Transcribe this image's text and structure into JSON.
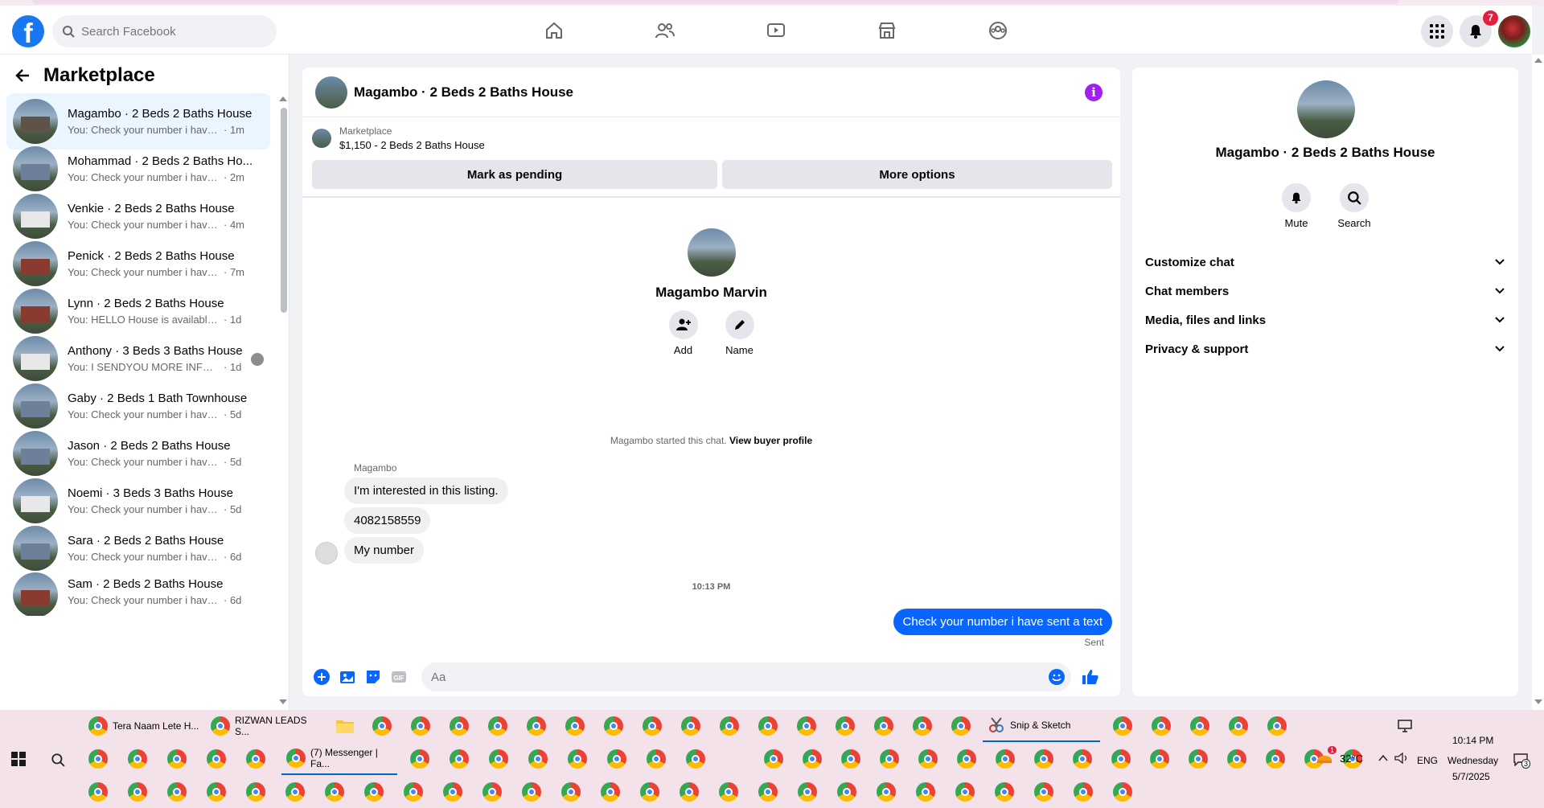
{
  "header": {
    "logo": "f",
    "search_placeholder": "Search Facebook",
    "notification_count": "7"
  },
  "left": {
    "title": "Marketplace",
    "conversations": [
      {
        "name": "Magambo · 2 Beds 2 Baths House",
        "preview": "You: Check your number i have se...",
        "time": "· 1m"
      },
      {
        "name": "Mohammad · 2 Beds 2 Baths Ho...",
        "preview": "You: Check your number i have se...",
        "time": "· 2m"
      },
      {
        "name": "Venkie · 2 Beds 2 Baths House",
        "preview": "You: Check your number i have se...",
        "time": "· 4m"
      },
      {
        "name": "Penick · 2 Beds 2 Baths House",
        "preview": "You: Check your number i have se...",
        "time": "· 7m"
      },
      {
        "name": "Lynn · 2 Beds 2 Baths House",
        "preview": "You: HELLO House is available for r...",
        "time": "· 1d"
      },
      {
        "name": "Anthony · 3 Beds 3 Baths House",
        "preview": "You: I SENDYOU MORE INFORM...",
        "time": "· 1d"
      },
      {
        "name": "Gaby · 2 Beds 1 Bath Townhouse",
        "preview": "You: Check your number i have sen...",
        "time": "· 5d"
      },
      {
        "name": "Jason · 2 Beds 2 Baths House",
        "preview": "You: Check your number i have sen...",
        "time": "· 5d"
      },
      {
        "name": "Noemi · 3 Beds 3 Baths House",
        "preview": "You: Check your number i have sen...",
        "time": "· 5d"
      },
      {
        "name": "Sara · 2 Beds 2 Baths House",
        "preview": "You: Check your number i have sen...",
        "time": "· 6d"
      },
      {
        "name": "Sam · 2 Beds 2 Baths House",
        "preview": "You: Check your number i have sen...",
        "time": "· 6d"
      }
    ]
  },
  "chat": {
    "title": "Magambo · 2 Beds 2 Baths House",
    "listing_source": "Marketplace",
    "listing_desc": "$1,150 - 2 Beds 2 Baths House",
    "btn_pending": "Mark as pending",
    "btn_more": "More options",
    "profile_name": "Magambo Marvin",
    "action_add": "Add",
    "action_name": "Name",
    "started_text": "Magambo started this chat.",
    "started_link": "View buyer profile",
    "sender": "Magambo",
    "messages": [
      "I'm interested in this listing.",
      "4082158559",
      "My number"
    ],
    "timestamp": "10:13 PM",
    "sent_message": "Check your number i have sent a text",
    "sent_label": "Sent",
    "composer_placeholder": "Aa"
  },
  "right": {
    "name": "Magambo · 2 Beds 2 Baths House",
    "mute": "Mute",
    "search": "Search",
    "sections": [
      "Customize chat",
      "Chat members",
      "Media, files and links",
      "Privacy & support"
    ]
  },
  "taskbar": {
    "row1_items": [
      "Tera Naam Lete H...",
      "RIZWAN LEADS S...",
      "Snip & Sketch"
    ],
    "row2_item": "(7) Messenger | Fa...",
    "weather": "32°C",
    "lang": "ENG",
    "time": "10:14 PM",
    "day": "Wednesday",
    "date": "5/7/2025",
    "weather_badge": "1",
    "notif_count": "3"
  }
}
